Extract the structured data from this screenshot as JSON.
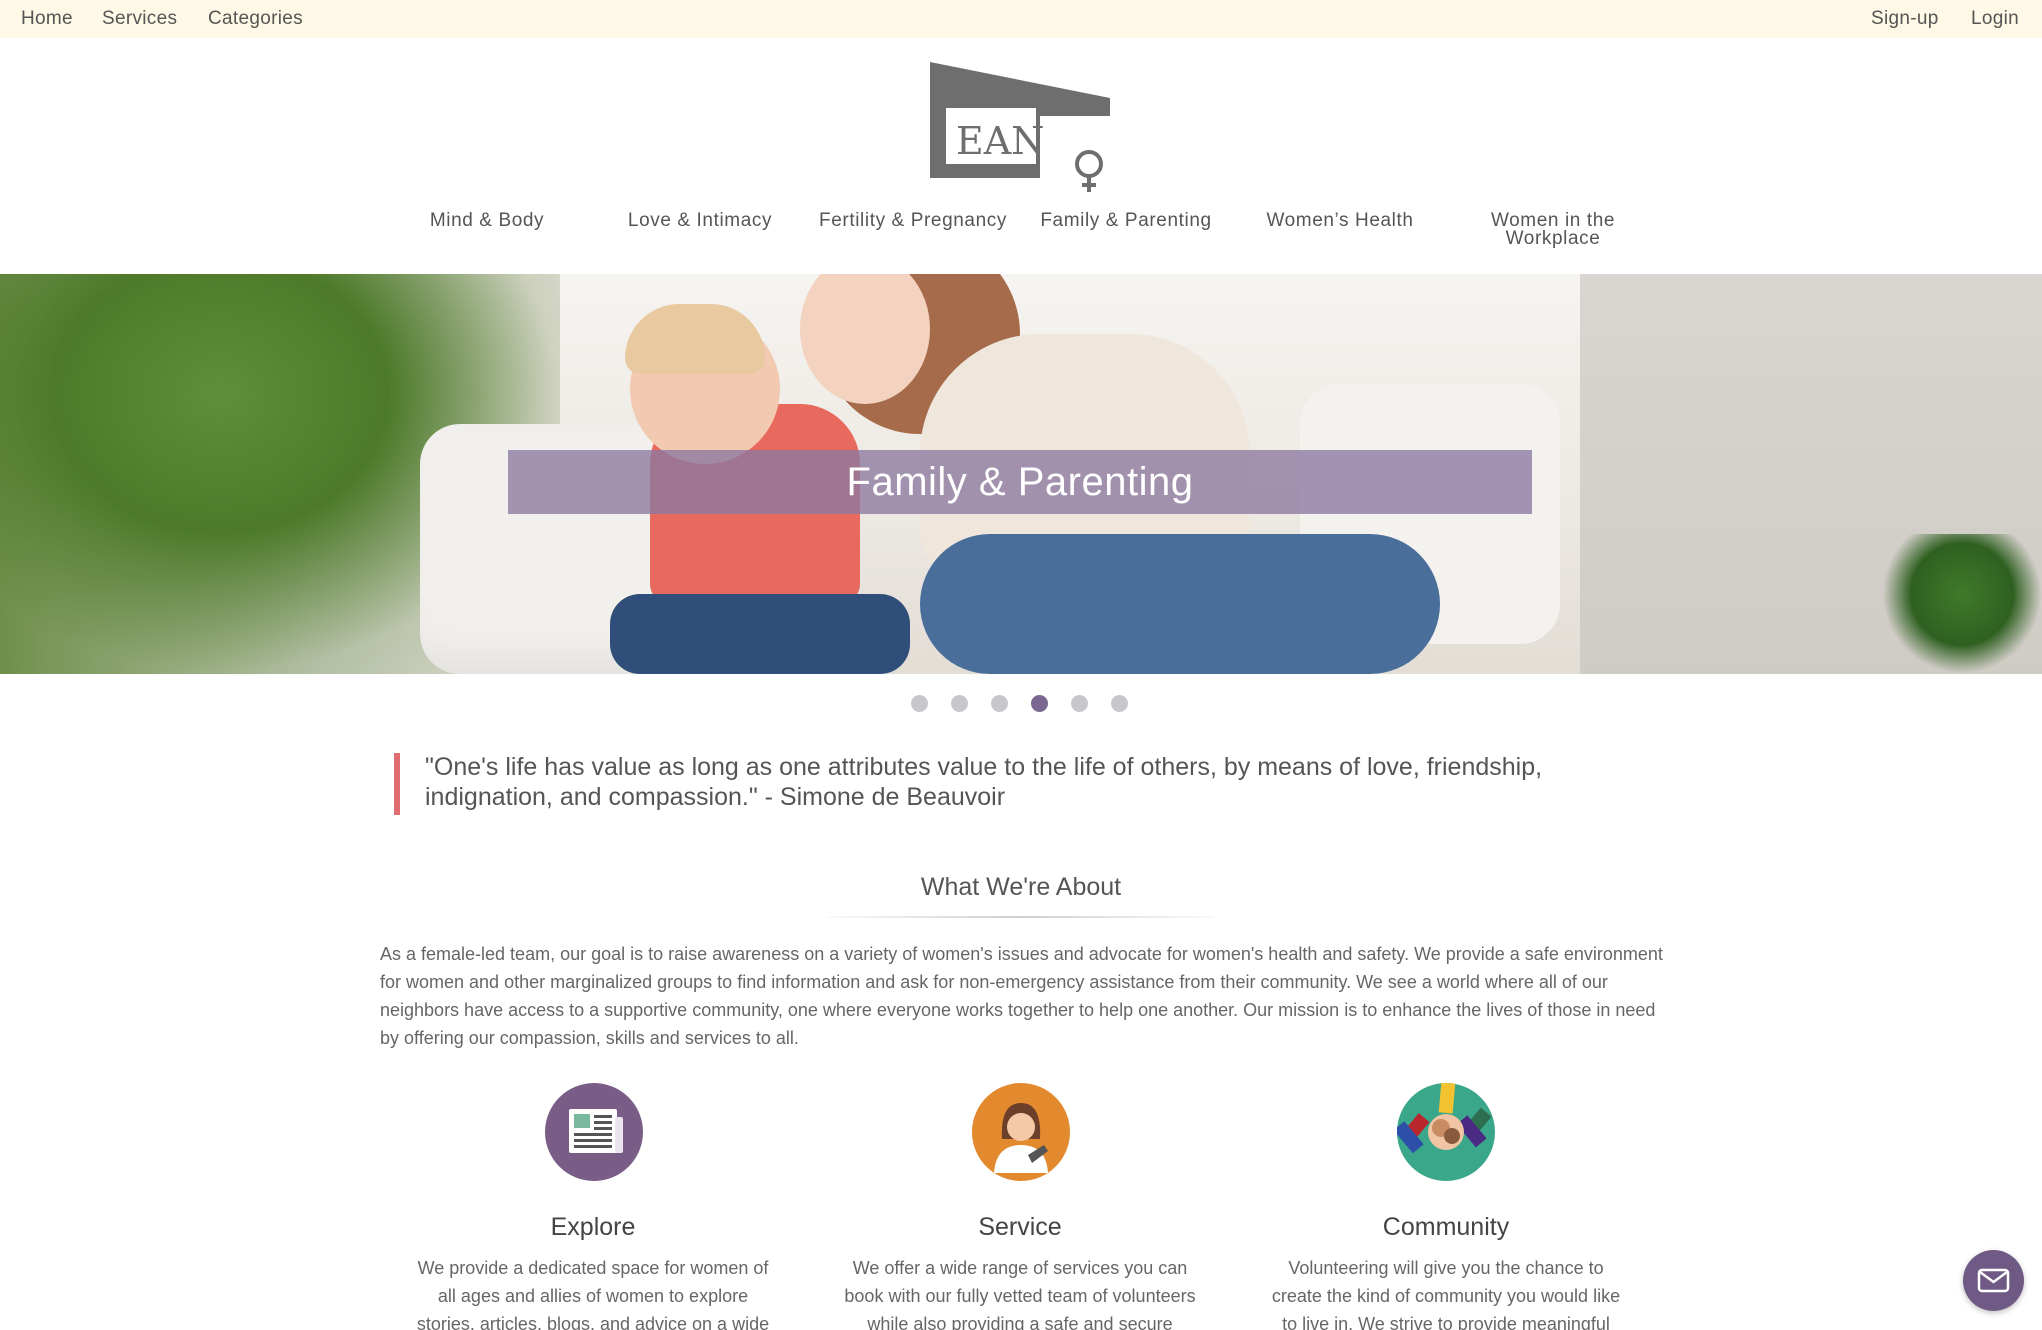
{
  "topbar": {
    "left": [
      "Home",
      "Services",
      "Categories"
    ],
    "right": [
      "Sign-up",
      "Login"
    ]
  },
  "logo": {
    "text": "EAN"
  },
  "categories": [
    "Mind & Body",
    "Love & Intimacy",
    "Fertility & Pregnancy",
    "Family & Parenting",
    "Women’s Health",
    "Women in the Workplace"
  ],
  "hero": {
    "title": "Family & Parenting",
    "slide_count": 6,
    "active_slide": 4
  },
  "quote": {
    "text": "\"One's life has value as long as one attributes value to the life of others, by means of love, friendship, indignation, and compassion.\" - Simone de Beauvoir"
  },
  "about": {
    "title": "What We're About",
    "body": "As a female-led team, our goal is to raise awareness on a variety of women's issues and advocate for women's health and safety. We provide a safe environment for women and other marginalized groups to find information and ask for non-emergency assistance from their community. We see a world where all of our neighbors have access to a supportive community, one where everyone works together to help one another. Our mission is to enhance the lives of those in need by offering our compassion, skills and services to all."
  },
  "features": [
    {
      "title": "Explore",
      "icon": "newspaper-icon",
      "color": "#7a5d86",
      "text": "We provide a dedicated space for women of all ages and allies of women to explore stories, articles, blogs, and advice on a wide"
    },
    {
      "title": "Service",
      "icon": "volunteer-woman-icon",
      "color": "#e38a2e",
      "text": "We offer a wide range of services you can book with our fully vetted team of volunteers while also providing a safe and secure"
    },
    {
      "title": "Community",
      "icon": "hands-together-icon",
      "color": "#3aa78b",
      "text": "Volunteering will give you the chance to create the kind of community you would like to live in. We strive to provide meaningful"
    }
  ],
  "colors": {
    "topbar_bg": "#fdf9e6",
    "accent_purple": "#7a6893",
    "quote_bar": "#e06d72"
  },
  "mail_button": {
    "icon": "mail-icon"
  }
}
